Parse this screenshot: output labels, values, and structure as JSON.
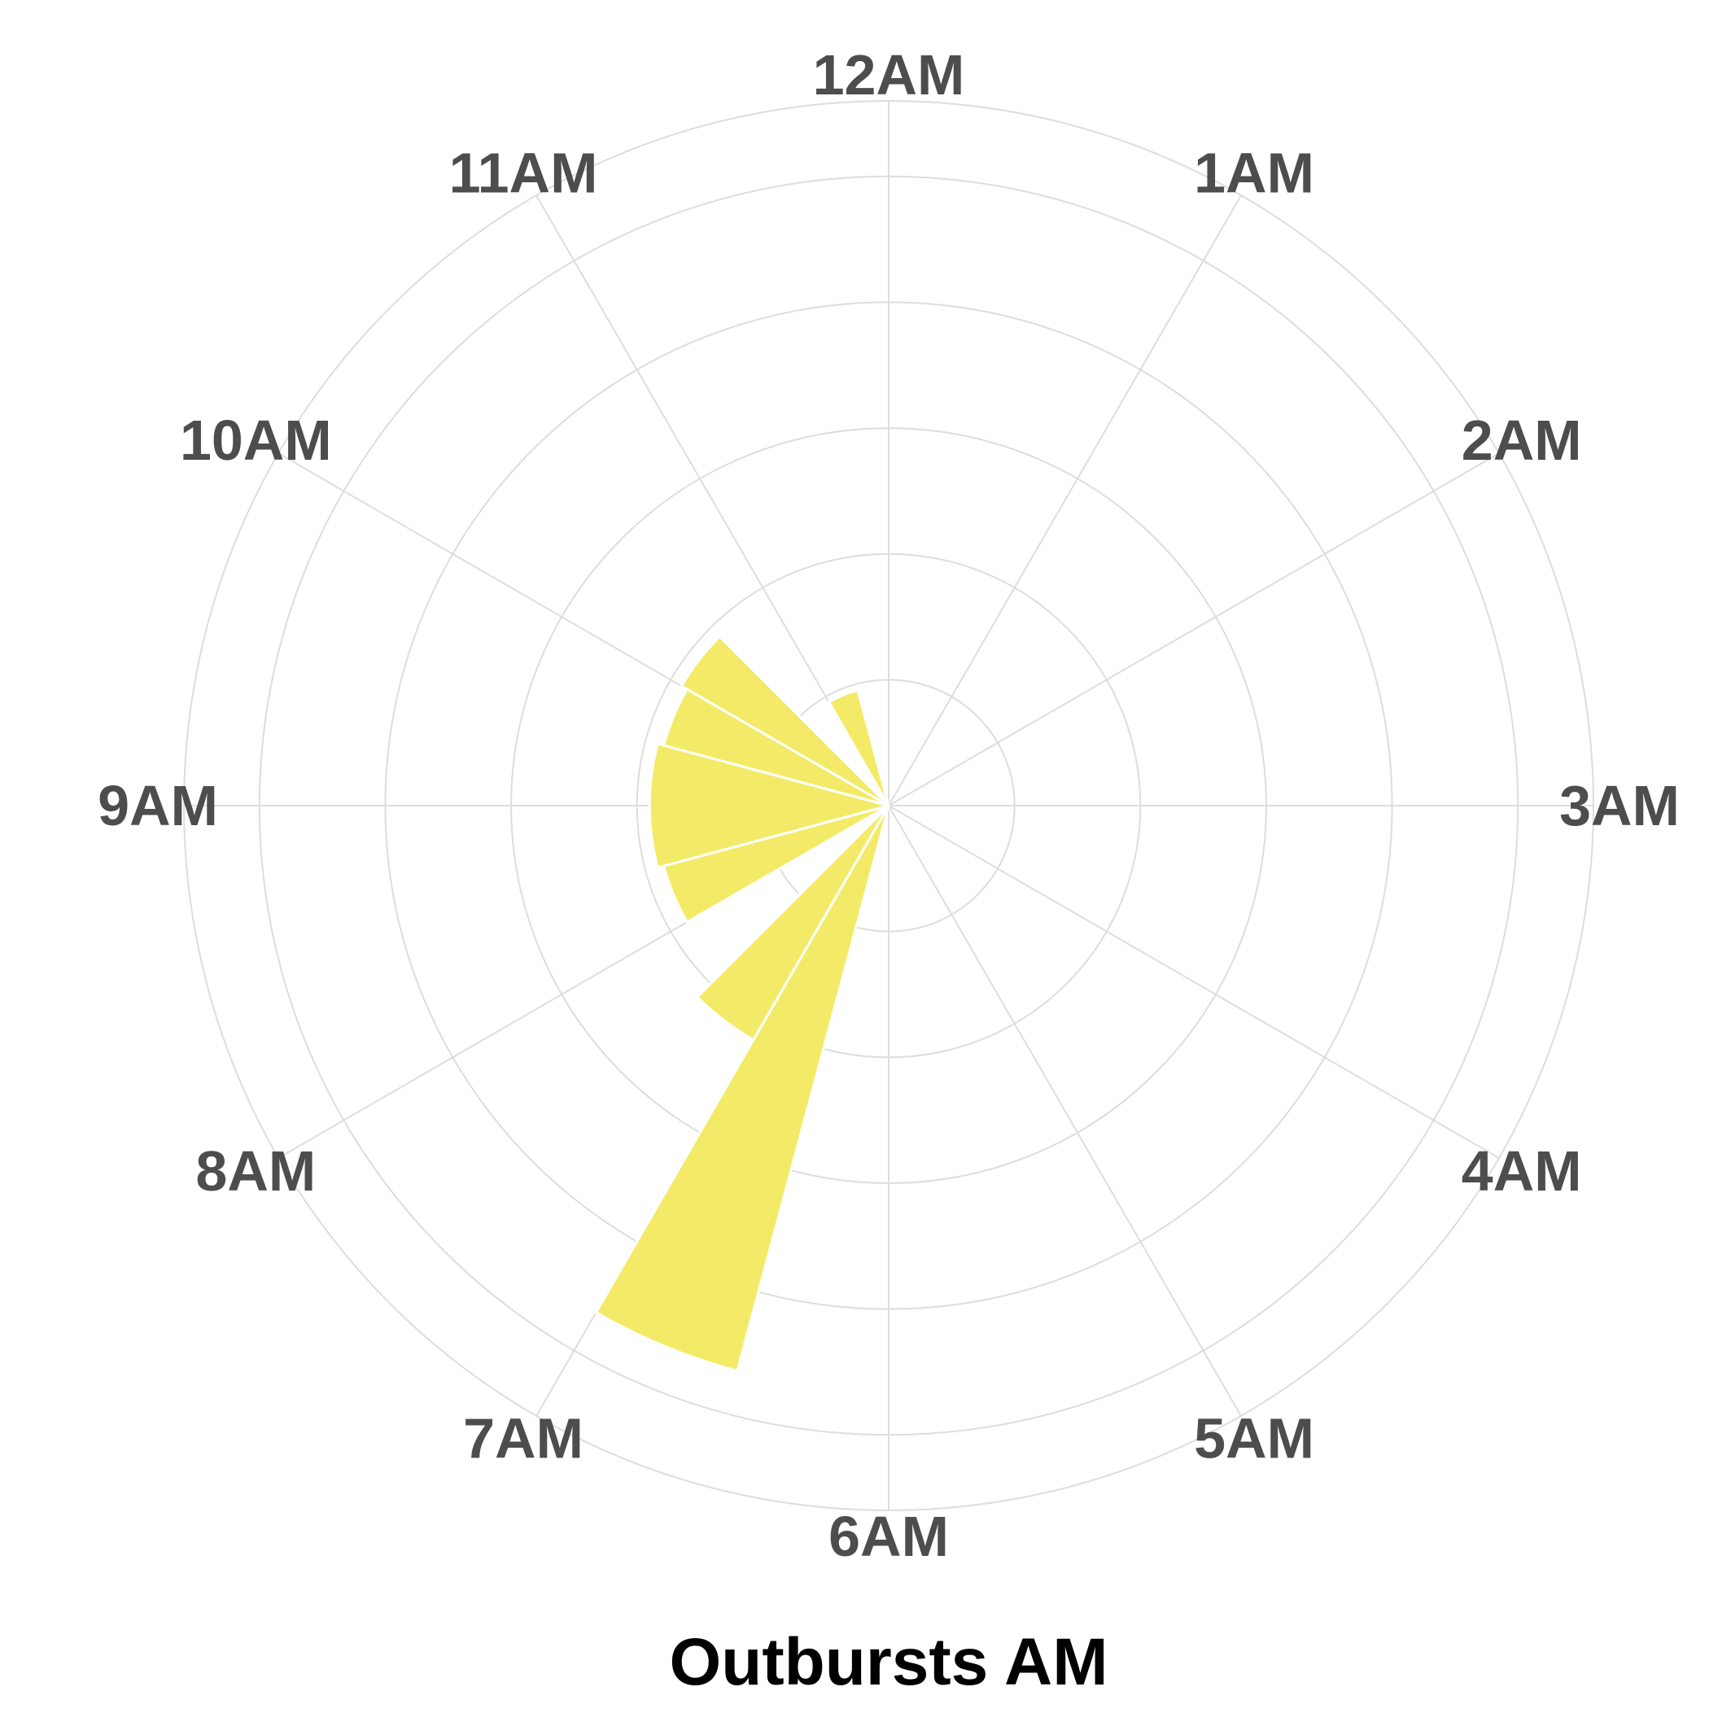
{
  "chart_data": {
    "type": "bar",
    "polar": true,
    "categories": [
      "12AM",
      "1AM",
      "2AM",
      "3AM",
      "4AM",
      "5AM",
      "6AM",
      "7AM",
      "8AM",
      "9AM",
      "10AM",
      "11AM"
    ],
    "bars": [
      {
        "label": "6AM",
        "start_hour": 6.5,
        "end_hour": 7.0,
        "value": 4.65
      },
      {
        "label": "7AM",
        "start_hour": 7.0,
        "end_hour": 7.5,
        "value": 2.15
      },
      {
        "label": "8AM",
        "start_hour": 8.0,
        "end_hour": 8.5,
        "value": 1.85
      },
      {
        "label": "9AM",
        "start_hour": 8.5,
        "end_hour": 9.5,
        "value": 1.9
      },
      {
        "label": "10AM",
        "start_hour": 9.5,
        "end_hour": 10.0,
        "value": 1.85
      },
      {
        "label": "11AM",
        "start_hour": 10.0,
        "end_hour": 10.5,
        "value": 1.9
      },
      {
        "label": "12AM",
        "start_hour": 11.0,
        "end_hour": 11.5,
        "value": 0.95
      }
    ],
    "rlim": [
      0,
      5.6
    ],
    "grid": true,
    "xlabel": "Outbursts AM",
    "ylabel": "",
    "colors": {
      "bar": "#F3EB67",
      "grid": "#DDDDDD",
      "tick_text": "#4D4D4D",
      "title_text": "#000000"
    }
  }
}
